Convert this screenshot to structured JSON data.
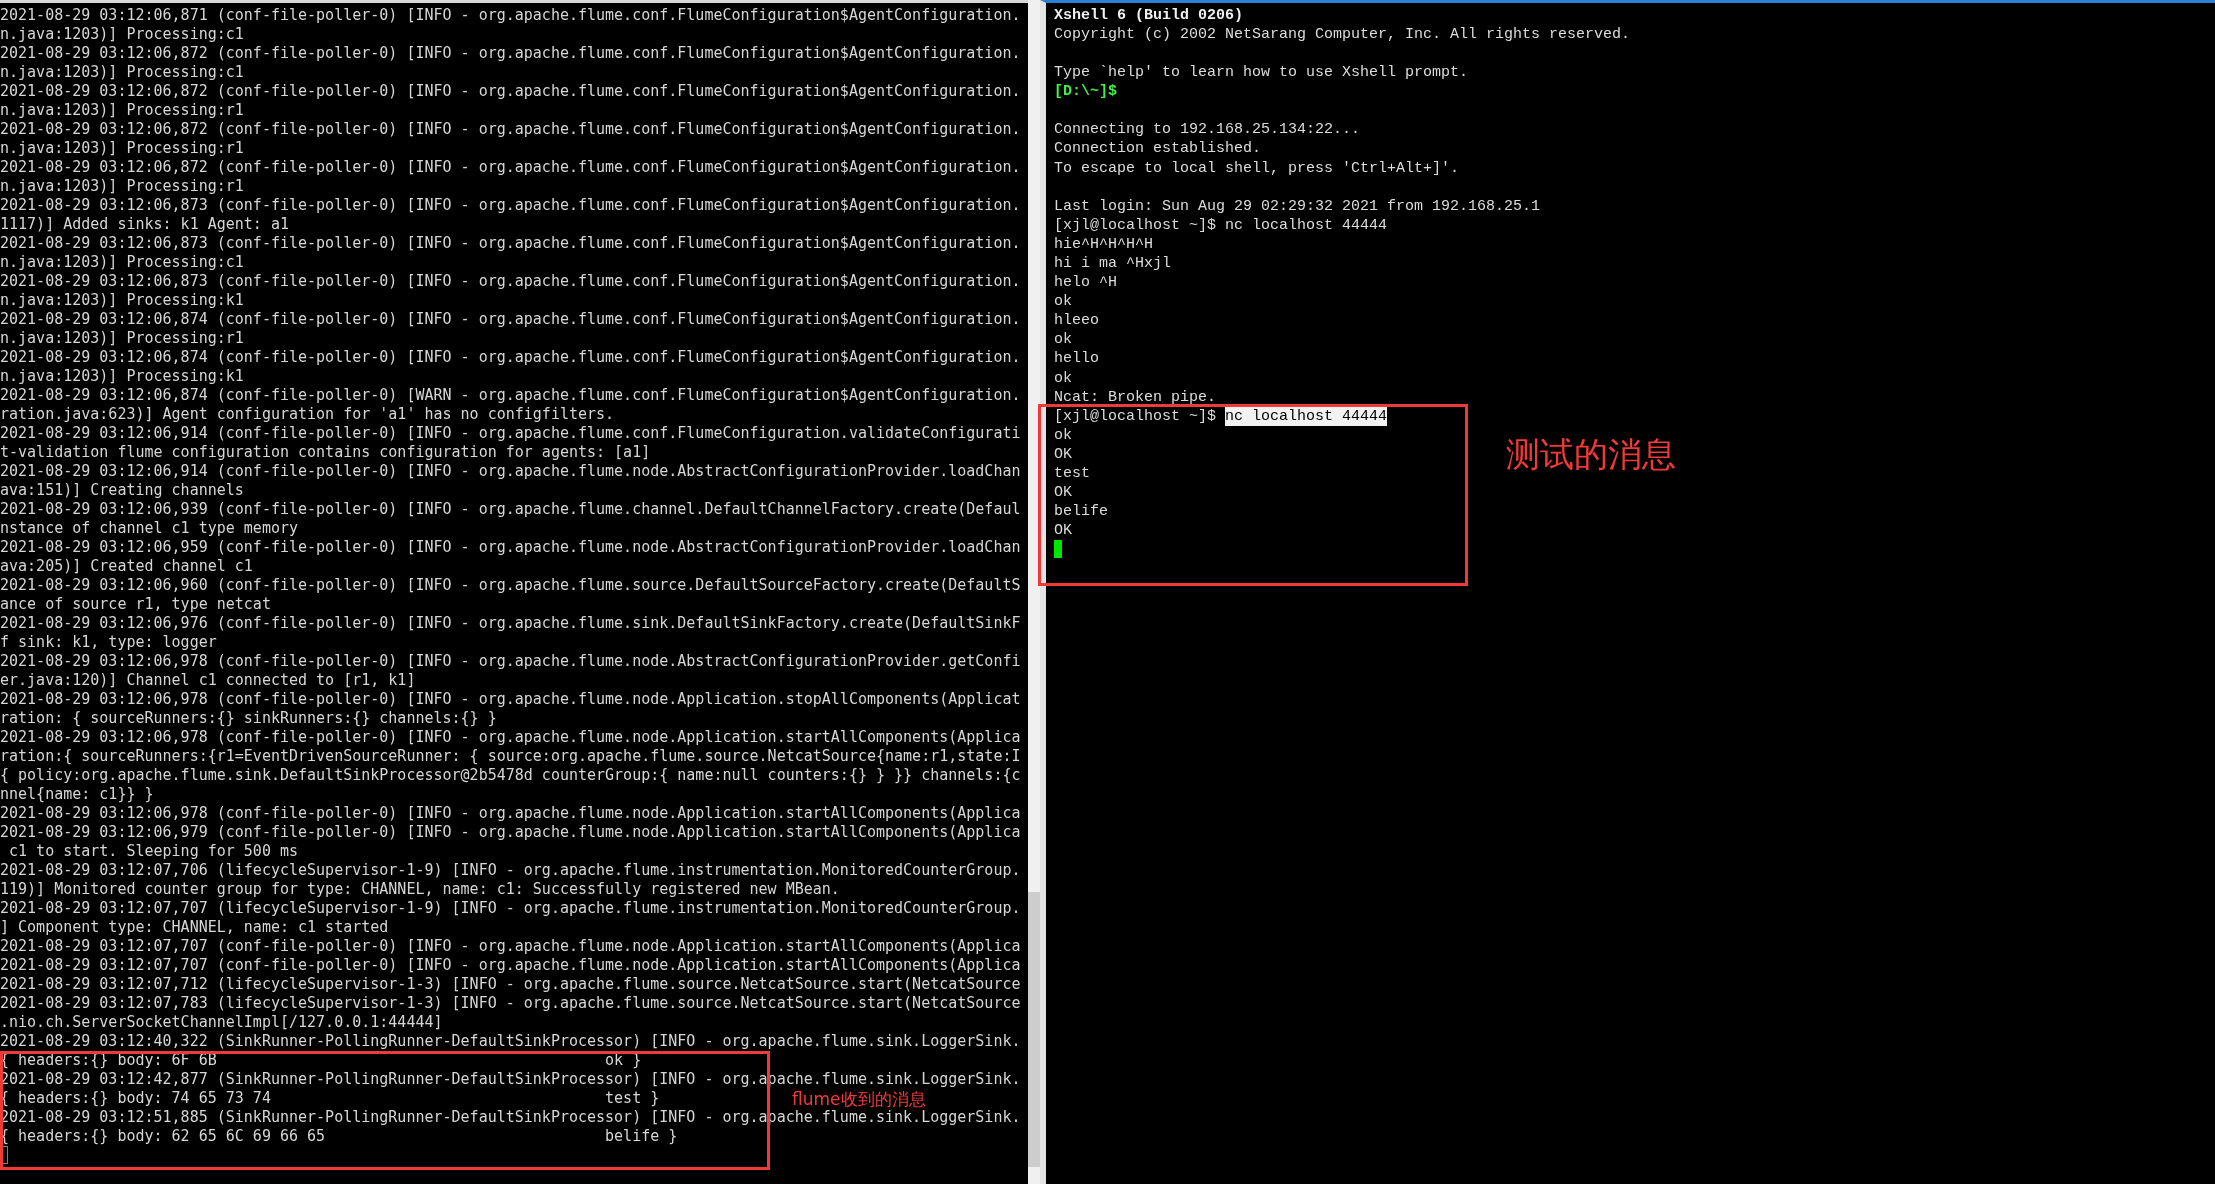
{
  "left_terminal": {
    "lines": [
      "2021-08-29 03:12:06,871 (conf-file-poller-0) [INFO - org.apache.flume.conf.FlumeConfiguration$AgentConfiguration.",
      "n.java:1203)] Processing:c1",
      "2021-08-29 03:12:06,872 (conf-file-poller-0) [INFO - org.apache.flume.conf.FlumeConfiguration$AgentConfiguration.",
      "n.java:1203)] Processing:c1",
      "2021-08-29 03:12:06,872 (conf-file-poller-0) [INFO - org.apache.flume.conf.FlumeConfiguration$AgentConfiguration.",
      "n.java:1203)] Processing:r1",
      "2021-08-29 03:12:06,872 (conf-file-poller-0) [INFO - org.apache.flume.conf.FlumeConfiguration$AgentConfiguration.",
      "n.java:1203)] Processing:r1",
      "2021-08-29 03:12:06,872 (conf-file-poller-0) [INFO - org.apache.flume.conf.FlumeConfiguration$AgentConfiguration.",
      "n.java:1203)] Processing:r1",
      "2021-08-29 03:12:06,873 (conf-file-poller-0) [INFO - org.apache.flume.conf.FlumeConfiguration$AgentConfiguration.",
      "1117)] Added sinks: k1 Agent: a1",
      "2021-08-29 03:12:06,873 (conf-file-poller-0) [INFO - org.apache.flume.conf.FlumeConfiguration$AgentConfiguration.",
      "n.java:1203)] Processing:c1",
      "2021-08-29 03:12:06,873 (conf-file-poller-0) [INFO - org.apache.flume.conf.FlumeConfiguration$AgentConfiguration.",
      "n.java:1203)] Processing:k1",
      "2021-08-29 03:12:06,874 (conf-file-poller-0) [INFO - org.apache.flume.conf.FlumeConfiguration$AgentConfiguration.",
      "n.java:1203)] Processing:r1",
      "2021-08-29 03:12:06,874 (conf-file-poller-0) [INFO - org.apache.flume.conf.FlumeConfiguration$AgentConfiguration.",
      "n.java:1203)] Processing:k1",
      "2021-08-29 03:12:06,874 (conf-file-poller-0) [WARN - org.apache.flume.conf.FlumeConfiguration$AgentConfiguration.",
      "ration.java:623)] Agent configuration for 'a1' has no configfilters.",
      "2021-08-29 03:12:06,914 (conf-file-poller-0) [INFO - org.apache.flume.conf.FlumeConfiguration.validateConfigurati",
      "t-validation flume configuration contains configuration for agents: [a1]",
      "2021-08-29 03:12:06,914 (conf-file-poller-0) [INFO - org.apache.flume.node.AbstractConfigurationProvider.loadChan",
      "ava:151)] Creating channels",
      "2021-08-29 03:12:06,939 (conf-file-poller-0) [INFO - org.apache.flume.channel.DefaultChannelFactory.create(Defaul",
      "nstance of channel c1 type memory",
      "2021-08-29 03:12:06,959 (conf-file-poller-0) [INFO - org.apache.flume.node.AbstractConfigurationProvider.loadChan",
      "ava:205)] Created channel c1",
      "2021-08-29 03:12:06,960 (conf-file-poller-0) [INFO - org.apache.flume.source.DefaultSourceFactory.create(DefaultS",
      "ance of source r1, type netcat",
      "2021-08-29 03:12:06,976 (conf-file-poller-0) [INFO - org.apache.flume.sink.DefaultSinkFactory.create(DefaultSinkF",
      "f sink: k1, type: logger",
      "2021-08-29 03:12:06,978 (conf-file-poller-0) [INFO - org.apache.flume.node.AbstractConfigurationProvider.getConfi",
      "er.java:120)] Channel c1 connected to [r1, k1]",
      "2021-08-29 03:12:06,978 (conf-file-poller-0) [INFO - org.apache.flume.node.Application.stopAllComponents(Applicat",
      "ration: { sourceRunners:{} sinkRunners:{} channels:{} }",
      "2021-08-29 03:12:06,978 (conf-file-poller-0) [INFO - org.apache.flume.node.Application.startAllComponents(Applica",
      "ration:{ sourceRunners:{r1=EventDrivenSourceRunner: { source:org.apache.flume.source.NetcatSource{name:r1,state:I",
      "{ policy:org.apache.flume.sink.DefaultSinkProcessor@2b5478d counterGroup:{ name:null counters:{} } }} channels:{c",
      "nnel{name: c1}} }",
      "2021-08-29 03:12:06,978 (conf-file-poller-0) [INFO - org.apache.flume.node.Application.startAllComponents(Applica",
      "2021-08-29 03:12:06,979 (conf-file-poller-0) [INFO - org.apache.flume.node.Application.startAllComponents(Applica",
      " c1 to start. Sleeping for 500 ms",
      "2021-08-29 03:12:07,706 (lifecycleSupervisor-1-9) [INFO - org.apache.flume.instrumentation.MonitoredCounterGroup.",
      "119)] Monitored counter group for type: CHANNEL, name: c1: Successfully registered new MBean.",
      "2021-08-29 03:12:07,707 (lifecycleSupervisor-1-9) [INFO - org.apache.flume.instrumentation.MonitoredCounterGroup.",
      "] Component type: CHANNEL, name: c1 started",
      "2021-08-29 03:12:07,707 (conf-file-poller-0) [INFO - org.apache.flume.node.Application.startAllComponents(Applica",
      "2021-08-29 03:12:07,707 (conf-file-poller-0) [INFO - org.apache.flume.node.Application.startAllComponents(Applica",
      "2021-08-29 03:12:07,712 (lifecycleSupervisor-1-3) [INFO - org.apache.flume.source.NetcatSource.start(NetcatSource",
      "2021-08-29 03:12:07,783 (lifecycleSupervisor-1-3) [INFO - org.apache.flume.source.NetcatSource.start(NetcatSource",
      ".nio.ch.ServerSocketChannelImpl[/127.0.0.1:44444]",
      "2021-08-29 03:12:40,322 (SinkRunner-PollingRunner-DefaultSinkProcessor) [INFO - org.apache.flume.sink.LoggerSink.",
      "{ headers:{} body: 6F 6B                                           ok }",
      "2021-08-29 03:12:42,877 (SinkRunner-PollingRunner-DefaultSinkProcessor) [INFO - org.apache.flume.sink.LoggerSink.",
      "{ headers:{} body: 74 65 73 74                                     test }",
      "2021-08-29 03:12:51,885 (SinkRunner-PollingRunner-DefaultSinkProcessor) [INFO - org.apache.flume.sink.LoggerSink.",
      "{ headers:{} body: 62 65 6C 69 66 65                               belife }"
    ],
    "cursor": {
      "focused": false
    },
    "annotation": {
      "label": "flume收到的消息"
    }
  },
  "right_terminal": {
    "blocks": [
      {
        "lines": [
          {
            "text": "Xshell 6 (Build 0206)",
            "kind": "bold"
          },
          {
            "text": "Copyright (c) 2002 NetSarang Computer, Inc. All rights reserved.",
            "kind": "plain"
          }
        ]
      },
      {
        "lines": [
          {
            "text": "Type `help' to learn how to use Xshell prompt.",
            "kind": "plain"
          },
          {
            "text": "[D:\\~]$",
            "kind": "prompt"
          }
        ]
      },
      {
        "lines": [
          {
            "text": "Connecting to 192.168.25.134:22...",
            "kind": "plain"
          },
          {
            "text": "Connection established.",
            "kind": "plain"
          },
          {
            "text": "To escape to local shell, press 'Ctrl+Alt+]'.",
            "kind": "plain"
          }
        ]
      },
      {
        "lines": [
          {
            "text": "Last login: Sun Aug 29 02:29:32 2021 from 192.168.25.1",
            "kind": "plain"
          },
          {
            "text": "[xjl@localhost ~]$ nc localhost 44444",
            "kind": "plain"
          },
          {
            "text": "hie^H^H^H^H",
            "kind": "plain"
          },
          {
            "text": "hi i ma ^Hxjl",
            "kind": "plain"
          },
          {
            "text": "helo ^H",
            "kind": "plain"
          },
          {
            "text": "ok",
            "kind": "plain"
          },
          {
            "text": "hleeo",
            "kind": "plain"
          },
          {
            "text": "ok",
            "kind": "plain"
          },
          {
            "text": "hello",
            "kind": "plain"
          },
          {
            "text": "ok",
            "kind": "plain"
          },
          {
            "text": "Ncat: Broken pipe.",
            "kind": "plain"
          },
          {
            "text": "[xjl@localhost ~]$",
            "kind": "selection",
            "highlighted": "nc localhost 44444"
          },
          {
            "text": "ok",
            "kind": "plain"
          },
          {
            "text": "OK",
            "kind": "plain"
          },
          {
            "text": "test",
            "kind": "plain"
          },
          {
            "text": "OK",
            "kind": "plain"
          },
          {
            "text": "belife",
            "kind": "plain"
          },
          {
            "text": "OK",
            "kind": "plain"
          }
        ]
      }
    ],
    "cursor": {
      "focused": true
    },
    "annotation": {
      "label": "测试的消息"
    }
  }
}
